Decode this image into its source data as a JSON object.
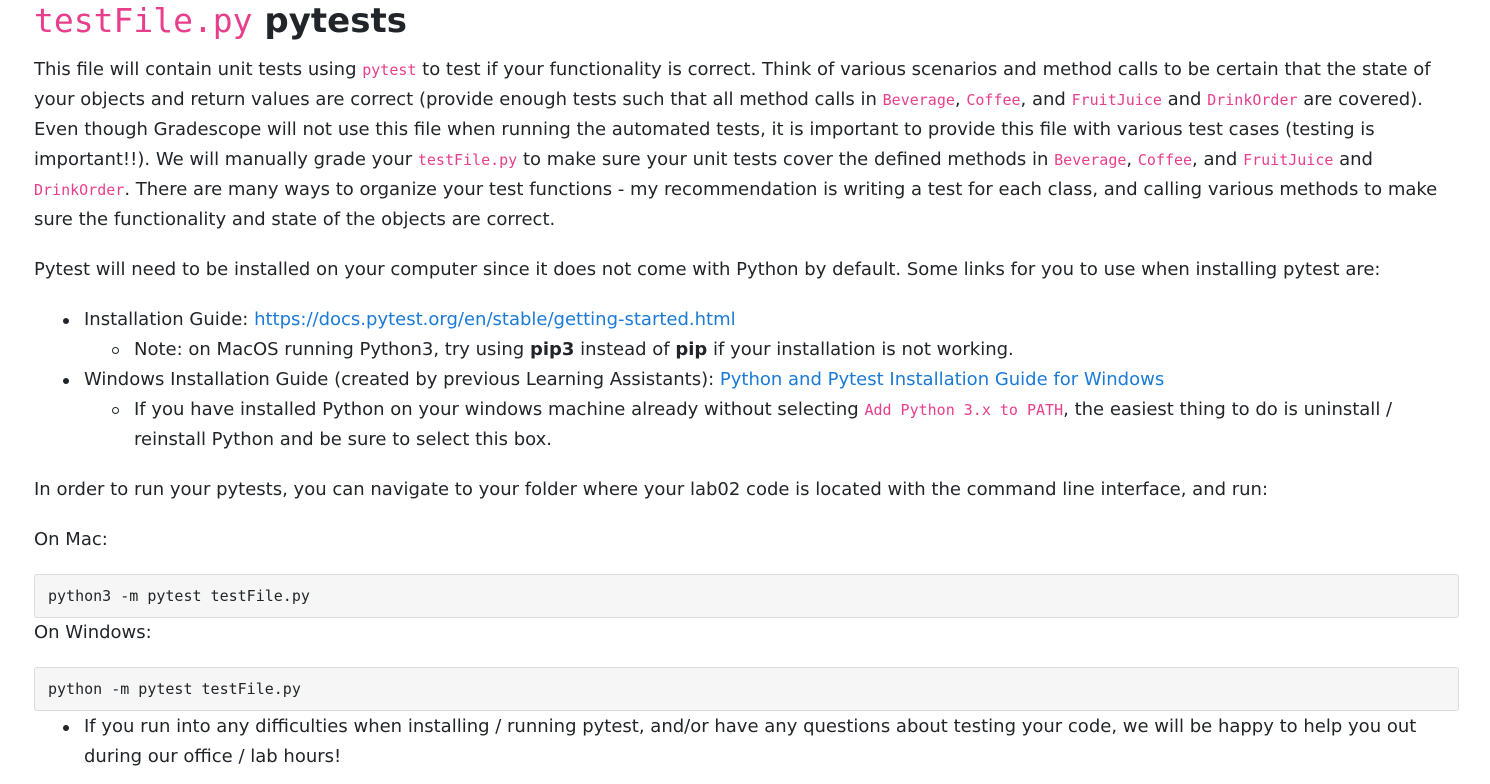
{
  "heading": {
    "code": "testFile.py",
    "text": "pytests"
  },
  "intro": {
    "t1": "This file will contain unit tests using ",
    "c1": "pytest",
    "t2": " to test if your functionality is correct. Think of various scenarios and method calls to be certain that the state of your objects and return values are correct (provide enough tests such that all method calls in ",
    "c2": "Beverage",
    "t3": ", ",
    "c3": "Coffee",
    "t4": ", and ",
    "c4": "FruitJuice",
    "t5": " and ",
    "c5": "DrinkOrder",
    "t6": " are covered). Even though Gradescope will not use this file when running the automated tests, it is important to provide this file with various test cases (testing is important!!). We will manually grade your ",
    "c6": "testFile.py",
    "t7": " to make sure your unit tests cover the defined methods in ",
    "c7": "Beverage",
    "t8": ", ",
    "c8": "Coffee",
    "t9": ", and ",
    "c9": "FruitJuice",
    "t10": " and ",
    "c10": "DrinkOrder",
    "t11": ". There are many ways to organize your test functions - my recommendation is writing a test for each class, and calling various methods to make sure the functionality and state of the objects are correct."
  },
  "install_para": "Pytest will need to be installed on your computer since it does not come with Python by default. Some links for you to use when installing pytest are:",
  "list": {
    "item1_label": "Installation Guide: ",
    "item1_link": "https://docs.pytest.org/en/stable/getting-started.html",
    "item1_sub": {
      "t1": "Note: on MacOS running Python3, try using ",
      "b1": "pip3",
      "t2": " instead of ",
      "b2": "pip",
      "t3": " if your installation is not working."
    },
    "item2_label": "Windows Installation Guide (created by previous Learning Assistants): ",
    "item2_link": "Python and Pytest Installation Guide for Windows",
    "item2_sub": {
      "t1": "If you have installed Python on your windows machine already without selecting ",
      "c1": "Add Python 3.x to PATH",
      "t2": ", the easiest thing to do is uninstall / reinstall Python and be sure to select this box."
    }
  },
  "run_para": "In order to run your pytests, you can navigate to your folder where your lab02 code is located with the command line interface, and run:",
  "mac_label": "On Mac:",
  "mac_cmd": "python3 -m pytest testFile.py",
  "win_label": "On Windows:",
  "win_cmd": "python -m pytest testFile.py",
  "help_item": "If you run into any difficulties when installing / running pytest, and/or have any questions about testing your code, we will be happy to help you out during our office / lab hours!"
}
